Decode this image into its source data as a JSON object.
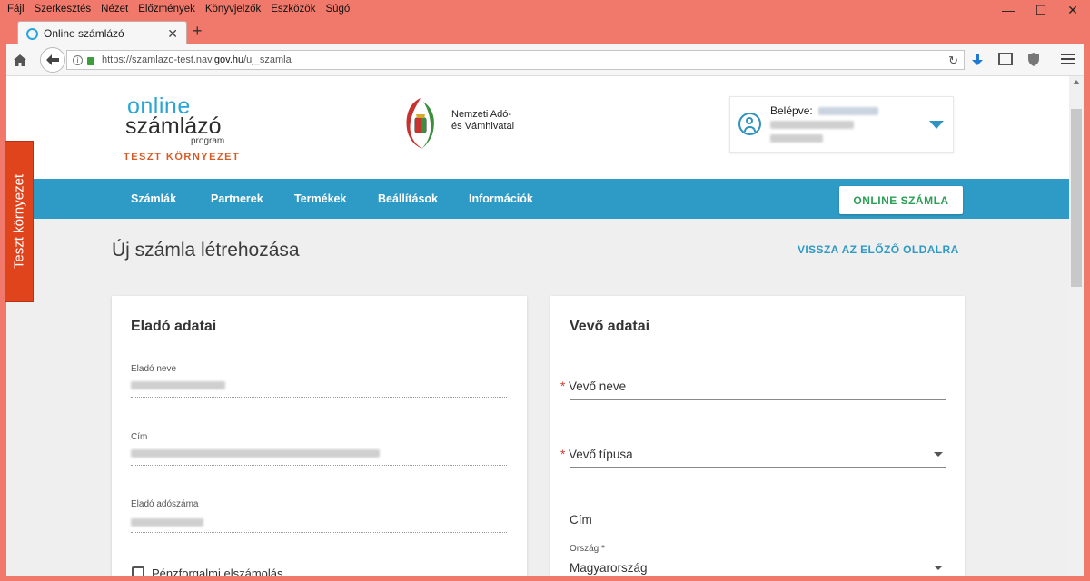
{
  "menu": [
    "Fájl",
    "Szerkesztés",
    "Nézet",
    "Előzmények",
    "Könyvjelzők",
    "Eszközök",
    "Súgó"
  ],
  "window_controls": {
    "minimize": "—",
    "maximize": "☐",
    "close": "✕"
  },
  "tab": {
    "title": "Online számlázó",
    "close": "✕",
    "new_tab": "+"
  },
  "url": {
    "prefix": "https://szamlazo-test.nav.",
    "domain": "gov.hu",
    "path": "/uj_szamla"
  },
  "header": {
    "logo_online": "online",
    "logo_szamlazo": "számlázó",
    "logo_program": "program",
    "teszt": "TESZT KÖRNYEZET",
    "authority_line1": "Nemzeti Adó-",
    "authority_line2": "és Vámhivatal",
    "user_label": "Belépve:"
  },
  "nav": {
    "items": [
      "Számlák",
      "Partnerek",
      "Termékek",
      "Beállítások",
      "Információk"
    ],
    "online_button": "ONLINE SZÁMLA"
  },
  "page": {
    "title": "Új számla létrehozása",
    "back_link": "VISSZA AZ ELŐZŐ OLDALRA"
  },
  "seller": {
    "title": "Eladó adatai",
    "name_label": "Eladó neve",
    "address_label": "Cím",
    "tax_label": "Eladó adószáma",
    "cash_accounting": "Pénzforgalmi elszámolás"
  },
  "buyer": {
    "title": "Vevő adatai",
    "required_mark": "*",
    "name_label": "Vevő neve",
    "type_label": "Vevő típusa",
    "address_heading": "Cím",
    "country_label": "Ország *",
    "country_value": "Magyarország"
  },
  "ribbon": "Teszt környezet",
  "colors": {
    "accent": "#2e9ac6",
    "titlebar": "#f1796b",
    "ribbon": "#e0441d",
    "green": "#2e9e57"
  }
}
